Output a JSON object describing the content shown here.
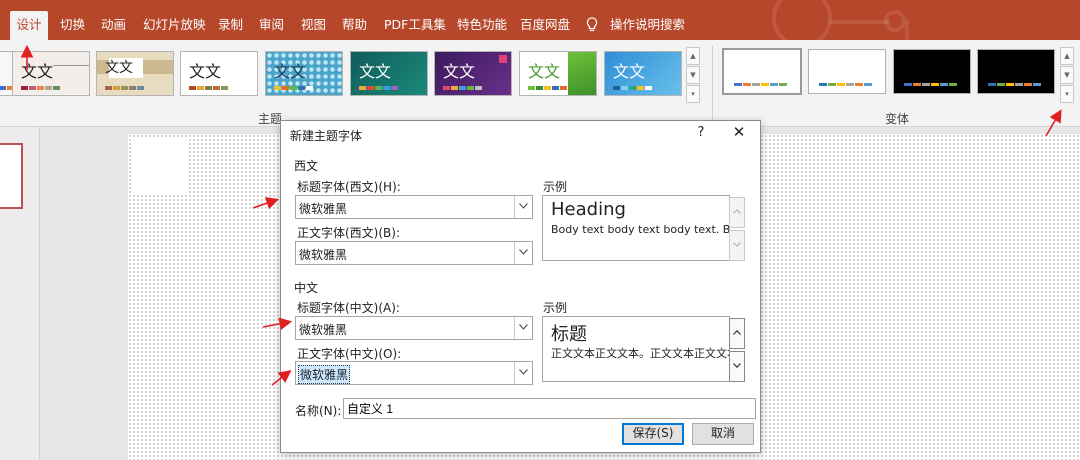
{
  "tabs": {
    "design": "设计",
    "transitions": "切换",
    "animations": "动画",
    "slideshow": "幻灯片放映",
    "record": "录制",
    "review": "审阅",
    "view": "视图",
    "help": "帮助",
    "pdf": "PDF工具集",
    "special": "特色功能",
    "baidu": "百度网盘",
    "search": "操作说明搜索"
  },
  "ribbon": {
    "theme_label": "主题",
    "variant_label": "变体",
    "theme_text": "文文"
  },
  "dialog": {
    "title": "新建主题字体",
    "help": "?",
    "close": "✕",
    "western": {
      "group": "西文",
      "heading_label": "标题字体(西文)(H):",
      "heading_value": "微软雅黑",
      "body_label": "正文字体(西文)(B):",
      "body_value": "微软雅黑",
      "sample_label": "示例",
      "sample_heading": "Heading",
      "sample_body": "Body text body text body text. Body"
    },
    "chinese": {
      "group": "中文",
      "heading_label": "标题字体(中文)(A):",
      "heading_value": "微软雅黑",
      "body_label": "正文字体(中文)(O):",
      "body_value": "微软雅黑",
      "sample_label": "示例",
      "sample_heading": "标题",
      "sample_body": "正文文本正文文本。正文文本正文文本。"
    },
    "name_label": "名称(N):",
    "name_value": "自定义 1",
    "save": "保存(S)",
    "cancel": "取消"
  },
  "colors": {
    "accent": "#b7472a",
    "annotation": "#e02020",
    "default_button": "#0078d7"
  }
}
